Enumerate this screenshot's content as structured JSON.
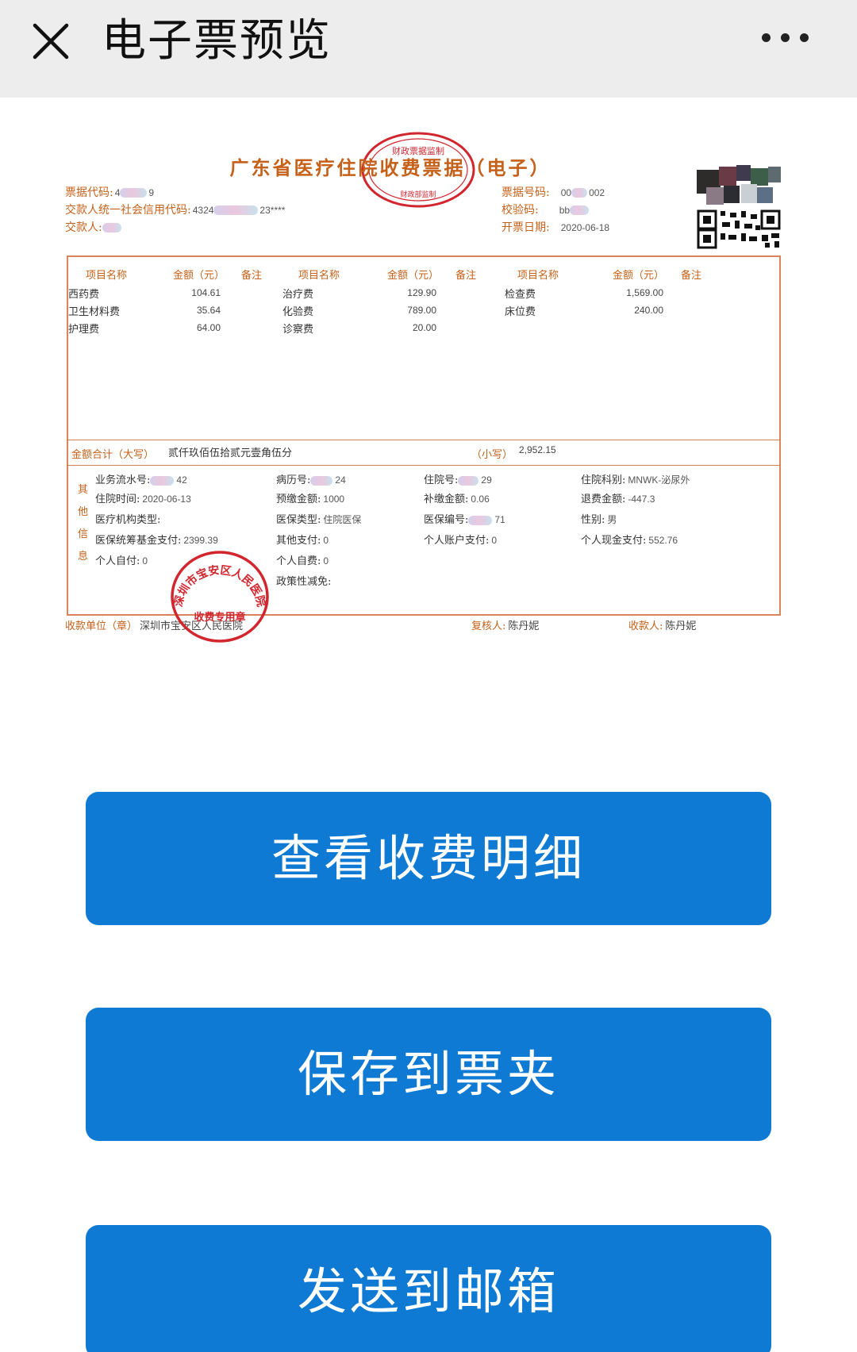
{
  "header": {
    "title": "电子票预览",
    "close_icon": "close-icon",
    "more_icon": "more-dots-icon"
  },
  "invoice": {
    "title": "广东省医疗住院收费票据（电子）",
    "top_stamp_text": "财政票据监制",
    "top_stamp_bottom_text": "财政部监制",
    "left_fields": [
      {
        "label": "票据代码:",
        "value": "4",
        "value_tail": "9"
      },
      {
        "label": "交款人统一社会信用代码:",
        "value": "4324",
        "value_tail": "23****"
      },
      {
        "label": "交款人:",
        "value": ""
      }
    ],
    "right_fields": [
      {
        "label": "票据号码:",
        "value": "00",
        "value_tail": "002"
      },
      {
        "label": "校验码:",
        "value": "bb"
      },
      {
        "label": "开票日期:",
        "value": "2020-06-18"
      }
    ],
    "col_headers": {
      "name": "项目名称",
      "amount": "金额（元）",
      "note": "备注"
    },
    "items": [
      {
        "name": "西药费",
        "amount": "104.61"
      },
      {
        "name": "卫生材料费",
        "amount": "35.64"
      },
      {
        "name": "护理费",
        "amount": "64.00"
      },
      {
        "name": "治疗费",
        "amount": "129.90"
      },
      {
        "name": "化验费",
        "amount": "789.00"
      },
      {
        "name": "诊察费",
        "amount": "20.00"
      },
      {
        "name": "检查费",
        "amount": "1,569.00"
      },
      {
        "name": "床位费",
        "amount": "240.00"
      }
    ],
    "total": {
      "label_upper": "金额合计（大写）",
      "value_upper": "贰仟玖佰伍拾贰元壹角伍分",
      "label_lower": "（小写）",
      "value_lower": "2,952.15"
    },
    "other_info_label": [
      "其",
      "他",
      "信",
      "息"
    ],
    "other": [
      {
        "label": "业务流水号:",
        "value": "42"
      },
      {
        "label": "病历号:",
        "value": "24"
      },
      {
        "label": "住院号:",
        "value": "29"
      },
      {
        "label": "住院科别:",
        "value": "MNWK-泌尿外"
      },
      {
        "label": "住院时间:",
        "value": "2020-06-13"
      },
      {
        "label": "预缴金额:",
        "value": "1000"
      },
      {
        "label": "补缴金额:",
        "value": "0.06"
      },
      {
        "label": "退费金额:",
        "value": "-447.3"
      },
      {
        "label": "医疗机构类型:",
        "value": ""
      },
      {
        "label": "医保类型:",
        "value": "住院医保"
      },
      {
        "label": "医保编号:",
        "value": "71"
      },
      {
        "label": "性别:",
        "value": "男"
      },
      {
        "label": "医保统筹基金支付:",
        "value": "2399.39"
      },
      {
        "label": "其他支付:",
        "value": "0"
      },
      {
        "label": "个人账户支付:",
        "value": "0"
      },
      {
        "label": "个人现金支付:",
        "value": "552.76"
      },
      {
        "label": "个人自付:",
        "value": "0"
      },
      {
        "label": "个人自费:",
        "value": "0"
      },
      {
        "label": "政策性减免:",
        "value": ""
      }
    ],
    "footer": {
      "payee_unit_label": "收款单位（章）",
      "payee_unit": "深圳市宝安区人民医院",
      "reviewer_label": "复核人:",
      "reviewer": "陈丹妮",
      "cashier_label": "收款人:",
      "cashier": "陈丹妮"
    },
    "bottom_stamp_text": "深圳市宝安区人民医院",
    "bottom_stamp_sub": "收费专用章",
    "stamp_color": "#d2262f",
    "ink_color": "#c5611a"
  },
  "buttons": {
    "view_details": "查看收费明细",
    "save_folder": "保存到票夹",
    "send_email": "发送到邮箱"
  },
  "colors": {
    "button_blue": "#0f7ad3",
    "topbar_bg": "#ededed"
  }
}
